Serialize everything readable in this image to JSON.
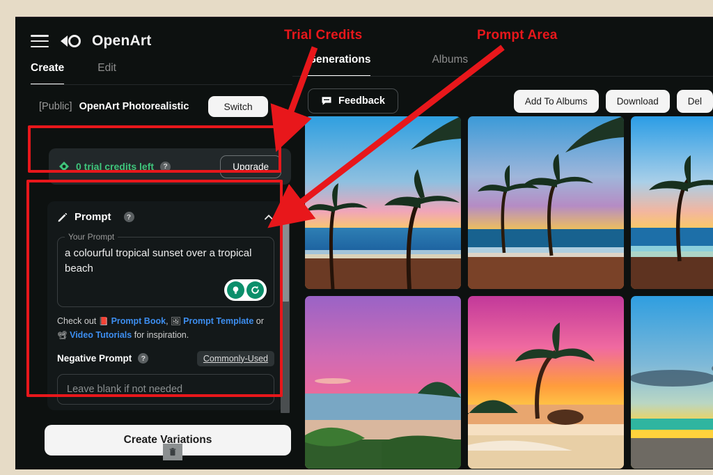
{
  "app": {
    "brand": "OpenArt",
    "logo_icon": "infinity-icon",
    "menu_icon": "hamburger-menu-icon"
  },
  "left_tabs": [
    {
      "label": "Create",
      "active": true
    },
    {
      "label": "Edit",
      "active": false
    }
  ],
  "model": {
    "visibility": "[Public]",
    "name": "OpenArt Photorealistic",
    "switch_label": "Switch"
  },
  "credits": {
    "icon": "diamond-icon",
    "text": "0 trial credits left",
    "help_icon": "question-mark-icon",
    "help_label": "?",
    "upgrade_label": "Upgrade",
    "accent_color": "#3fc47b"
  },
  "prompt_panel": {
    "edit_icon": "pencil-icon",
    "title": "Prompt",
    "help_label": "?",
    "collapse_icon": "chevron-up-icon",
    "field_legend": "Your Prompt",
    "prompt_value": "a colourful tropical sunset over a tropical beach",
    "idea_icon": "lightbulb-icon",
    "refresh_icon": "refresh-icon",
    "checkout": {
      "prefix": "Check out",
      "book_emoji": "closed-book-icon",
      "book_link": "Prompt Book",
      "comma": ",",
      "template_emoji": "picture-icon",
      "template_link": "Prompt Template",
      "or": "or",
      "video_emoji": "film-projector-icon",
      "video_link": "Video Tutorials",
      "suffix": "for inspiration."
    },
    "negative_label": "Negative Prompt",
    "negative_help_label": "?",
    "commonly_used_label": "Commonly-Used",
    "negative_placeholder": "Leave blank if not needed"
  },
  "create_button": {
    "label": "Create Variations",
    "trash_icon": "trash-icon"
  },
  "right_tabs": [
    {
      "label": "Generations",
      "active": true
    },
    {
      "label": "Albums",
      "active": false
    }
  ],
  "toolbar": {
    "feedback_icon": "speech-bubble-icon",
    "feedback_label": "Feedback",
    "add_to_albums_label": "Add To Albums",
    "download_label": "Download",
    "delete_label": "Del"
  },
  "gallery": {
    "row1": [
      {
        "name": "sunset-palms-blue-sky",
        "sky_top": "#2f9fe0",
        "sky_mid": "#f0a5b8",
        "sun": "#ffd84d",
        "glow": "#ff9a1f",
        "sea": "#1b5f9e",
        "sand": "#6b3a24"
      },
      {
        "name": "sunset-palms-orange-clouds",
        "sky_top": "#3b9ad8",
        "sky_mid": "#b58cc4",
        "sun": "#ffcf3c",
        "glow": "#ff7a18",
        "sea": "#18628f",
        "sand": "#7a4228"
      },
      {
        "name": "sunset-palm-bright-blue",
        "sky_top": "#2b9de6",
        "sky_mid": "#f2b6a0",
        "sun": "#ffd24a",
        "glow": "#ff8c22",
        "sea": "#1d6fa8",
        "sand": "#5e3320"
      }
    ],
    "row2": [
      {
        "name": "pink-purple-bay-sunset",
        "sky_top": "#9a63c6",
        "sky_mid": "#e86ba0",
        "sun": "#ffd58a",
        "glow": "#f4804f",
        "sea": "#79a7c4",
        "sand": "#d9b79e"
      },
      {
        "name": "pink-sunset-lone-palm",
        "sky_top": "#c2399a",
        "sky_mid": "#f06aa0",
        "sun": "#ffd24a",
        "glow": "#ff9c3c",
        "sea": "#e8a66f",
        "sand": "#e8cfa6"
      },
      {
        "name": "teal-yellow-beach-sunset",
        "sky_top": "#2f9ee0",
        "sky_mid": "#7fb9d8",
        "sun": "#ffd23c",
        "glow": "#e6b82c",
        "sea": "#2fb5a0",
        "sand": "#6e6a63"
      }
    ]
  },
  "annotations": {
    "trial_credits": "Trial Credits",
    "prompt_area": "Prompt Area",
    "color": "#e8171b"
  }
}
